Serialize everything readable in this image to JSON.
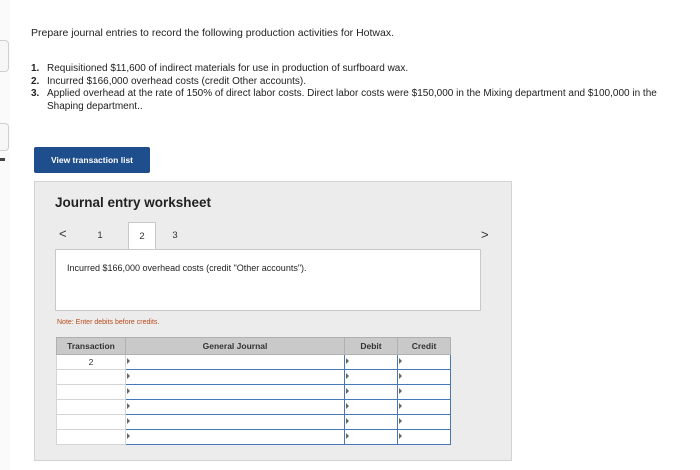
{
  "prompt": {
    "text": "Prepare journal entries to record the following production activities for Hotwax."
  },
  "requirements": [
    {
      "num": "1.",
      "text": "Requisitioned $11,600 of indirect materials for use in production of surfboard wax."
    },
    {
      "num": "2.",
      "text": "Incurred $166,000 overhead costs (credit Other accounts)."
    },
    {
      "num": "3.",
      "text": "Applied overhead at the rate of 150% of direct labor costs. Direct labor costs were $150,000 in the Mixing department and $100,000 in the Shaping department.."
    }
  ],
  "buttons": {
    "view_transactions": "View transaction list"
  },
  "worksheet": {
    "title": "Journal entry worksheet",
    "nav_prev": "<",
    "nav_next": ">",
    "tabs": [
      "1",
      "2",
      "3"
    ],
    "active_tab": "2",
    "description": "Incurred $166,000 overhead costs (credit \"Other accounts\").",
    "note": "Note: Enter debits before credits.",
    "table": {
      "headers": [
        "Transaction",
        "General Journal",
        "Debit",
        "Credit"
      ],
      "rows": [
        {
          "transaction": "2"
        },
        {
          "transaction": ""
        },
        {
          "transaction": ""
        },
        {
          "transaction": ""
        },
        {
          "transaction": ""
        },
        {
          "transaction": ""
        }
      ]
    }
  },
  "colors": {
    "button_bg": "#1f4e8c",
    "note_text": "#b84a1a",
    "input_border": "#4677b7",
    "header_bg": "#c9c9c9",
    "panel_bg": "#ececec"
  }
}
